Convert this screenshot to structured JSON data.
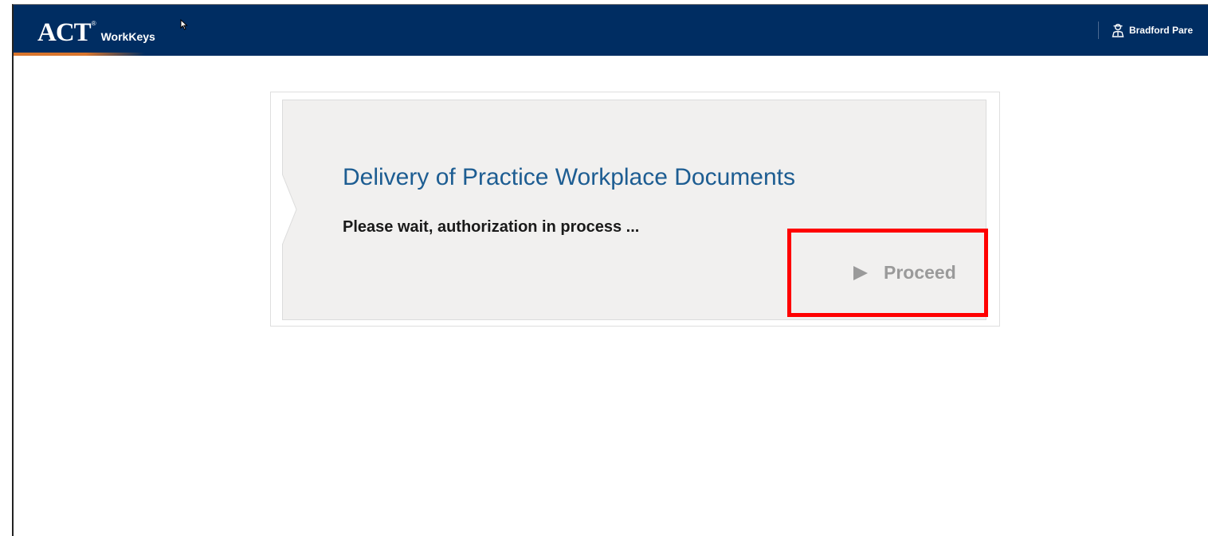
{
  "header": {
    "logo_act": "ACT",
    "logo_reg": "®",
    "logo_workkeys": "WorkKeys",
    "logo_workkeys_reg": "®",
    "user_name": "Bradford Pare",
    "user_icon": "user-icon",
    "accent_color": "#d9752d",
    "bar_color": "#002d62"
  },
  "card": {
    "title": "Delivery of Practice Workplace Documents",
    "message": "Please wait, authorization in process ...",
    "proceed_label": "Proceed",
    "proceed_icon": "play-icon"
  },
  "annotation": {
    "highlight_color": "#ff0000"
  }
}
